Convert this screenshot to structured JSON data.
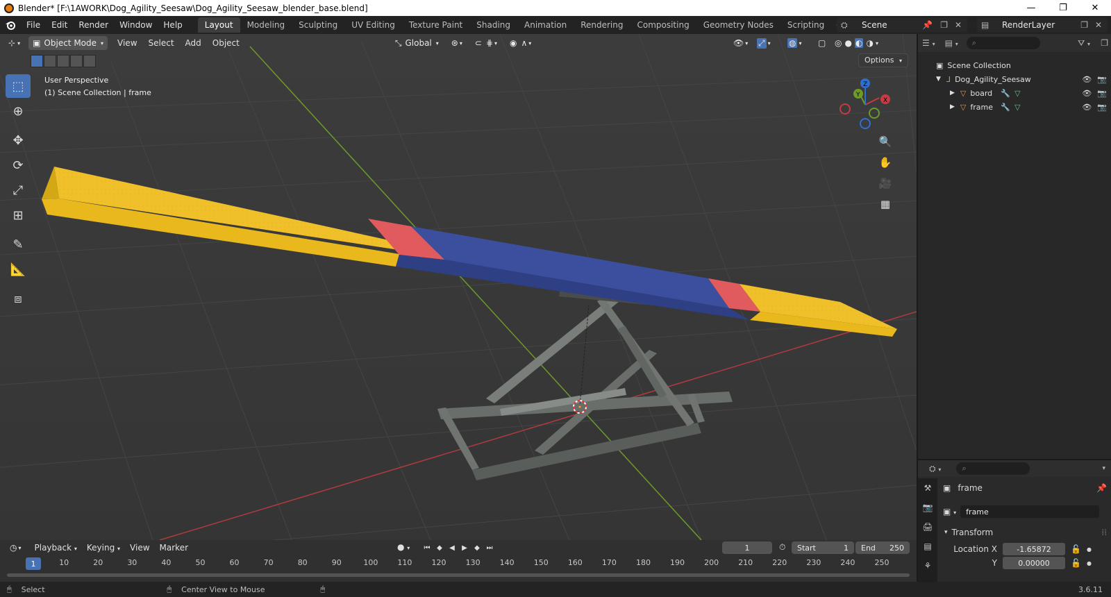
{
  "window": {
    "title": "Blender* [F:\\1AWORK\\Dog_Agility_Seesaw\\Dog_Agility_Seesaw_blender_base.blend]",
    "minimize": "—",
    "maximize": "❐",
    "close": "✕"
  },
  "menu": [
    "File",
    "Edit",
    "Render",
    "Window",
    "Help"
  ],
  "workspaces": [
    "Layout",
    "Modeling",
    "Sculpting",
    "UV Editing",
    "Texture Paint",
    "Shading",
    "Animation",
    "Rendering",
    "Compositing",
    "Geometry Nodes",
    "Scripting"
  ],
  "workspace_add": "+",
  "scene": {
    "name": "Scene"
  },
  "render_layer": {
    "name": "RenderLayer"
  },
  "viewport": {
    "mode": "Object Mode",
    "menus": [
      "View",
      "Select",
      "Add",
      "Object"
    ],
    "orientation": "Global",
    "info_line1": "User Perspective",
    "info_line2": "(1) Scene Collection | frame",
    "options": "Options",
    "gizmo": {
      "x": "X",
      "y": "Y",
      "z": "Z"
    }
  },
  "timeline": {
    "menus": [
      "Playback",
      "Keying",
      "View",
      "Marker"
    ],
    "current_frame": "1",
    "start_label": "Start",
    "start_value": "1",
    "end_label": "End",
    "end_value": "250",
    "ticks": [
      "1",
      "10",
      "20",
      "30",
      "40",
      "50",
      "60",
      "70",
      "80",
      "90",
      "100",
      "110",
      "120",
      "130",
      "140",
      "150",
      "160",
      "170",
      "180",
      "190",
      "200",
      "210",
      "220",
      "230",
      "240",
      "250"
    ]
  },
  "statusbar": {
    "select": "Select",
    "center_view": "Center View to Mouse",
    "version": "3.6.11"
  },
  "outliner": {
    "root": "Scene Collection",
    "collection": "Dog_Agility_Seesaw",
    "objects": [
      "board",
      "frame"
    ]
  },
  "properties": {
    "object_name": "frame",
    "data_name": "frame",
    "panel": "Transform",
    "location_x_label": "Location X",
    "location_x": "-1.65872",
    "location_y_label": "Y",
    "location_y": "0.00000"
  },
  "colors": {
    "accent": "#4772b3",
    "board_yellow": "#f2c21b",
    "board_blue": "#3b4f9e",
    "board_red": "#e0555a",
    "axis_x": "#c83a44",
    "axis_y": "#6e9a2a",
    "axis_z": "#2e6fd0"
  }
}
